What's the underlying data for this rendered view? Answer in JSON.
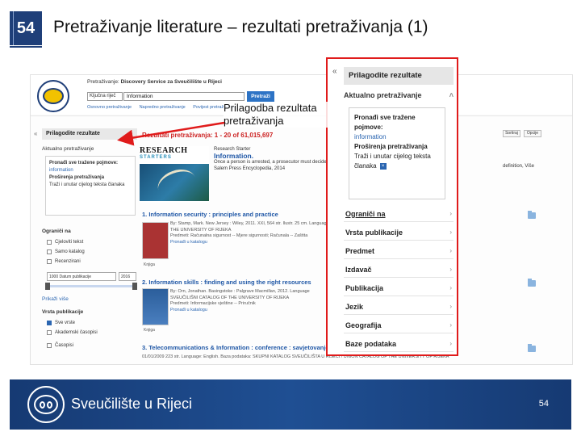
{
  "slide": {
    "number": "54",
    "title": "Pretraživanje literature – rezultati pretraživanja (1)",
    "callout": "Prilagodba rezultata pretraživanja",
    "page_number": "54"
  },
  "footer": {
    "institution": "Sveučilište u Rijeci"
  },
  "screenshot": {
    "search": {
      "label_prefix": "Pretraživanje:",
      "label_source": "Discovery Service za Sveučilište u Rijeci",
      "field_type": "Ključna riječ",
      "query": "Information",
      "button": "Pretraži",
      "links": [
        "Osnovno pretraživanje",
        "Napredno pretraživanje",
        "Povijest pretraživanja"
      ]
    },
    "left_sidebar": {
      "header": "Prilagodite rezultate",
      "current_search": "Aktualno pretraživanje",
      "box_line1": "Pronađi sve tražene pojmove:",
      "box_term": "information",
      "box_expanders": "Proširenja pretraživanja",
      "box_fulltext": "Traži i unutar cijelog teksta članaka",
      "limit_to": "Ograniči na",
      "checks": [
        "Cjeloviti tekst",
        "Samo katalog",
        "Recenzirani"
      ],
      "date_from": "1000",
      "date_label": "Datum publikacije",
      "date_to": "2016",
      "show_more": "Prikaži više",
      "pub_type": "Vrsta publikacije",
      "pub_checks": [
        "Sve vrste",
        "Akademski časopisi",
        "Časopisi"
      ]
    },
    "results": {
      "header": "Rezultati pretraživanja: 1 - 20 of 61,015,697",
      "research_word": "RESEARCH",
      "starters_word": "STARTERS",
      "research_starter_label": "Research Starter",
      "research_starter_title": "Information.",
      "research_starter_text": "Once a person is arrested, a prosecutor must decide whether or not",
      "research_starter_source": "Salem Press Encyclopedia, 2014",
      "right_link": "definition, Više",
      "items": [
        {
          "title": "1. Information security : principles and practice",
          "meta1": "By: Stamp, Mark. New Jersey : Wiley, 2011. XXI, 564 str. Ilustr. 25 cm. Language",
          "meta2": "THE UNIVERSITY OF RIJEKA",
          "meta3": "Predmeti: Računalna sigurnost -- Mjere sigurnosti; Računala -- Zaštita",
          "find": "Pronađi u katalogu",
          "type": "Knjiga"
        },
        {
          "title": "2. Information skills : finding and using the right resources",
          "meta1": "By: Orn, Jonathan. Basingstoke : Palgrave Macmillan, 2012. Language",
          "meta2": "SVEUČILIŠNI CATALOG OF THE UNIVERSITY OF RIJEKA",
          "meta3": "Predmeti: Informacijske vještine -- Priručnik",
          "find": "Pronađi u katalogu",
          "type": "Knjiga"
        },
        {
          "title": "3. Telecommunications & Information : conference : savjetovanje",
          "meta1": "01/01/2009 223 str. Language: English. Baza podataka: SKUPNI KATALOG SVEUČILIŠTA U RIJECI / UNION CATALOG OF THE UNIVERSITY OF RIJEKA",
          "meta2": "",
          "meta3": "",
          "find": "",
          "type": ""
        }
      ],
      "tools": [
        "Sortiraj",
        "Opcije"
      ]
    },
    "right_panel": {
      "header": "Prilagodite rezultate",
      "current_search": "Aktualno pretraživanje",
      "box_line1": "Pronađi sve tražene pojmove:",
      "box_term": "information",
      "box_expanders": "Proširenja pretraživanja",
      "box_fulltext": "Traži i unutar cijelog teksta članaka",
      "facets": [
        "Ograniči na",
        "Vrsta publikacije",
        "Predmet",
        "Izdavač",
        "Publikacija",
        "Jezik",
        "Geografija",
        "Baze podataka"
      ]
    }
  },
  "colors": {
    "brand_blue": "#1f3f79",
    "highlight_red": "#e01b1b",
    "link_blue": "#2b66b1"
  }
}
